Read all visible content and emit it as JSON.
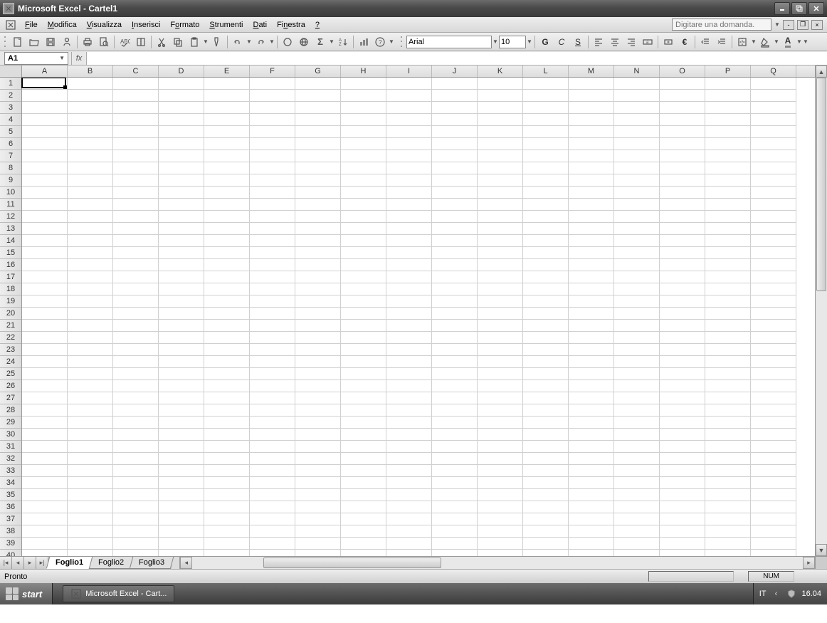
{
  "titlebar": {
    "title": "Microsoft Excel - Cartel1"
  },
  "menubar": {
    "items": [
      {
        "label": "File",
        "u": 0
      },
      {
        "label": "Modifica",
        "u": 0
      },
      {
        "label": "Visualizza",
        "u": 0
      },
      {
        "label": "Inserisci",
        "u": 0
      },
      {
        "label": "Formato",
        "u": 1
      },
      {
        "label": "Strumenti",
        "u": 0
      },
      {
        "label": "Dati",
        "u": 0
      },
      {
        "label": "Finestra",
        "u": 2
      },
      {
        "label": "?",
        "u": 0
      }
    ],
    "help_placeholder": "Digitare una domanda."
  },
  "formatting": {
    "font": "Arial",
    "size": "10",
    "bold": "G",
    "italic": "C",
    "underline": "S",
    "currency": "€"
  },
  "namebox": {
    "ref": "A1",
    "fx": "fx"
  },
  "grid": {
    "columns": [
      "A",
      "B",
      "C",
      "D",
      "E",
      "F",
      "G",
      "H",
      "I",
      "J",
      "K",
      "L",
      "M",
      "N",
      "O",
      "P",
      "Q"
    ],
    "rows_start": 1,
    "rows_end": 40,
    "active": {
      "col": 0,
      "row": 0
    }
  },
  "sheets": {
    "tabs": [
      "Foglio1",
      "Foglio2",
      "Foglio3"
    ],
    "active": 0
  },
  "statusbar": {
    "ready": "Pronto",
    "numlock": "NUM"
  },
  "taskbar": {
    "start": "start",
    "task": "Microsoft Excel - Cart...",
    "lang": "IT",
    "clock": "16.04"
  }
}
